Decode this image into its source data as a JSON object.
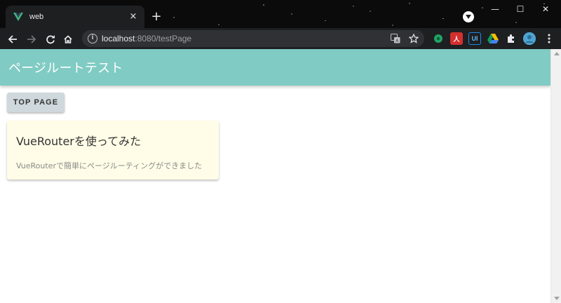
{
  "browser": {
    "tab": {
      "title": "web",
      "favicon": "vue-logo-icon",
      "close_label": "×"
    },
    "new_tab_label": "+",
    "window_controls": {
      "minimize_label": "—",
      "maximize_label": "☐",
      "close_label": "✕"
    },
    "toolbar": {
      "back_icon": "back-arrow-icon",
      "forward_icon": "forward-arrow-icon",
      "reload_icon": "reload-icon",
      "home_icon": "home-icon"
    },
    "address": {
      "host": "localhost",
      "path": ":8080/testPage",
      "info_icon_label": "i"
    },
    "extensions": [
      {
        "name": "green-extension-icon",
        "color": "#21a366"
      },
      {
        "name": "pdf-extension-icon",
        "color": "#d32f2f",
        "label": "人"
      },
      {
        "name": "ui-extension-icon",
        "color": "#1565c0",
        "label": "UI"
      },
      {
        "name": "drive-extension-icon",
        "color": "#fbbc04"
      },
      {
        "name": "puzzle-extension-icon",
        "color": "#e8eaed"
      },
      {
        "name": "profile-avatar-icon",
        "color": "#4fa3d1"
      },
      {
        "name": "more-menu-icon",
        "color": "#e8eaed"
      }
    ]
  },
  "app": {
    "title": "ページルートテスト",
    "bar_color": "#80cbc4"
  },
  "nav_button": {
    "label": "TOP PAGE"
  },
  "card": {
    "title": "VueRouterを使ってみた",
    "text": "VueRouterで簡単にページルーティングができました",
    "background": "#fffde7"
  }
}
